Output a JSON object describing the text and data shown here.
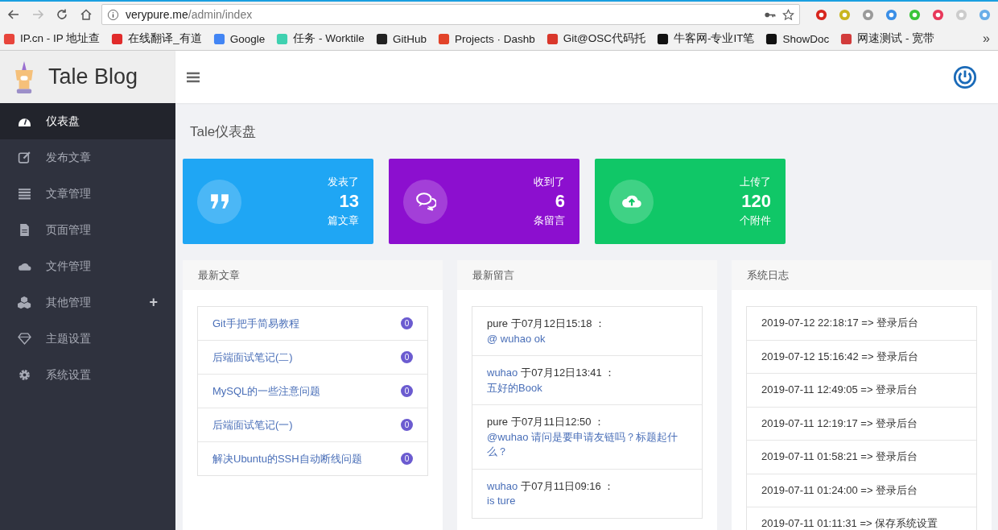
{
  "browser": {
    "url_host": "verypure.me",
    "url_path": "/admin/index",
    "bookmarks": [
      {
        "label": "IP.cn - IP 地址查",
        "color": "#e8453c"
      },
      {
        "label": "在线翻译_有道",
        "color": "#e12b2b"
      },
      {
        "label": "Google",
        "color": "#4285f4"
      },
      {
        "label": "任务 - Worktile",
        "color": "#3fd1b0"
      },
      {
        "label": "GitHub",
        "color": "#222222"
      },
      {
        "label": "Projects · Dashb",
        "color": "#e24329"
      },
      {
        "label": "Git@OSC代码托",
        "color": "#d9372b"
      },
      {
        "label": "牛客网-专业IT笔",
        "color": "#111111"
      },
      {
        "label": "ShowDoc",
        "color": "#111111"
      },
      {
        "label": "网速测试 - 宽带",
        "color": "#d23b3b"
      }
    ],
    "more": "»"
  },
  "brand": "Tale Blog",
  "sidebar": {
    "items": [
      {
        "label": "仪表盘",
        "kind": "dashboard",
        "selected": true
      },
      {
        "label": "发布文章",
        "kind": "edit",
        "selected": false
      },
      {
        "label": "文章管理",
        "kind": "list",
        "selected": false
      },
      {
        "label": "页面管理",
        "kind": "file",
        "selected": false
      },
      {
        "label": "文件管理",
        "kind": "cloud",
        "selected": false
      },
      {
        "label": "其他管理",
        "kind": "cubes",
        "selected": false,
        "toggle": "+"
      },
      {
        "label": "主题设置",
        "kind": "diamond",
        "selected": false
      },
      {
        "label": "系统设置",
        "kind": "gear",
        "selected": false
      }
    ]
  },
  "page_title": "Tale仪表盘",
  "stats": [
    {
      "kind": "quote",
      "color": "#1fa6f4",
      "top": "发表了",
      "value": "13",
      "bottom": "篇文章"
    },
    {
      "kind": "comments",
      "color": "#8c0fcf",
      "top": "收到了",
      "value": "6",
      "bottom": "条留言"
    },
    {
      "kind": "upload",
      "color": "#10c767",
      "top": "上传了",
      "value": "120",
      "bottom": "个附件"
    }
  ],
  "recent_posts": {
    "title": "最新文章",
    "items": [
      {
        "title": "Git手把手简易教程",
        "count": "0"
      },
      {
        "title": "后端面试笔记(二)",
        "count": "0"
      },
      {
        "title": "MySQL的一些注意问题",
        "count": "0"
      },
      {
        "title": "后端面试笔记(一)",
        "count": "0"
      },
      {
        "title": "解决Ubuntu的SSH自动断线问题",
        "count": "0"
      }
    ]
  },
  "recent_comments": {
    "title": "最新留言",
    "items": [
      {
        "author": "pure",
        "author_link": false,
        "time": "于07月12日15:18 ：",
        "text": "@ wuhao ok"
      },
      {
        "author": "wuhao",
        "author_link": true,
        "time": "于07月12日13:41 ：",
        "text": "五好的Book"
      },
      {
        "author": "pure",
        "author_link": false,
        "time": "于07月11日12:50 ：",
        "text": "@wuhao 请问是要申请友链吗？标题起什么？"
      },
      {
        "author": "wuhao",
        "author_link": true,
        "time": "于07月11日09:16 ：",
        "text": "is ture"
      }
    ]
  },
  "system_log": {
    "title": "系统日志",
    "items": [
      "2019-07-12 22:18:17 => 登录后台",
      "2019-07-12 15:16:42 => 登录后台",
      "2019-07-11 12:49:05 => 登录后台",
      "2019-07-11 12:19:17 => 登录后台",
      "2019-07-11 01:58:21 => 登录后台",
      "2019-07-11 01:24:00 => 登录后台",
      "2019-07-11 01:11:31 => 保存系统设置"
    ]
  }
}
